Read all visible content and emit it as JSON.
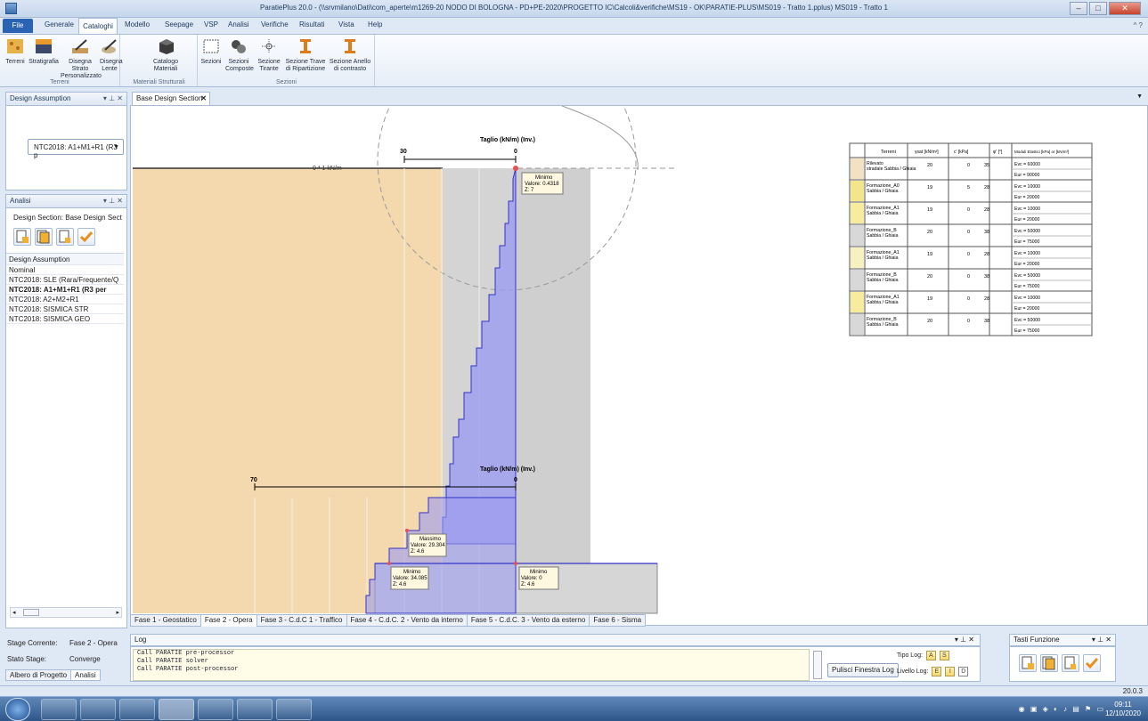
{
  "window": {
    "title": "ParatiePlus 20.0 - (\\\\srvmilano\\Dati\\com_aperte\\m1269-20  NODO DI BOLOGNA - PD+PE-2020\\PROGETTO IC\\Calcoli&verifiche\\MS19 - OK\\PARATIE-PLUS\\MS019 - Tratto 1.pplus) MS019 - Tratto 1"
  },
  "menu": {
    "file": "File",
    "items": [
      "Generale",
      "Cataloghi",
      "Modello",
      "Seepage",
      "VSP",
      "Analisi",
      "Verifiche",
      "Risultati",
      "Vista",
      "Help"
    ],
    "active": "Cataloghi"
  },
  "ribbon": {
    "groups": [
      {
        "label": "Terreni",
        "buttons": [
          "Terreni",
          "Stratigrafia",
          "Disegna Strato Personalizzato",
          "Disegna Lente"
        ]
      },
      {
        "label": "Materiali Strutturali",
        "buttons": [
          "Catalogo Materiali"
        ]
      },
      {
        "label": "Sezioni",
        "buttons": [
          "Sezioni",
          "Sezioni Composte",
          "Sezione Tirante",
          "Sezione Trave di Ripartizione",
          "Sezione Anello di contrasto"
        ]
      }
    ]
  },
  "design_panel": {
    "title": "Design Assumption",
    "selected": "NTC2018: A1+M1+R1 (R3 p"
  },
  "analisi_panel": {
    "title": "Analisi",
    "section_label": "Design Section:  Base Design Sect",
    "list_header": "Design Assumption",
    "items": [
      "Nominal",
      "NTC2018: SLE (Rara/Frequente/Q",
      "NTC2018: A1+M1+R1 (R3 per",
      "NTC2018: A2+M2+R1",
      "NTC2018: SISMICA STR",
      "NTC2018: SISMICA GEO"
    ],
    "bold_item": 2
  },
  "doc_tab": "Base Design Section",
  "canvas": {
    "chart1": {
      "title": "Taglio (kN/m) (Inv.)",
      "left_tick": "30",
      "right_tick": "0"
    },
    "chart2": {
      "title": "Taglio (kN/m) (Inv.)",
      "left_tick": "70",
      "right_tick": "0"
    },
    "load_label": "0 * 1 kN/m",
    "tooltips": [
      {
        "lines": [
          "Minimo",
          "Valore: 0.4318",
          "Z:       7"
        ]
      },
      {
        "lines": [
          "Massimo",
          "Valore: 29.304",
          "Z:       4.6"
        ]
      },
      {
        "lines": [
          "Minimo",
          "Valore: 34.085",
          "Z:       4.6"
        ]
      },
      {
        "lines": [
          "Minimo",
          "Valore:  0",
          "Z:       4.6"
        ]
      }
    ],
    "soil_table": {
      "headers": [
        "Terreni",
        "γsat [kN/m³]",
        "c' [kPa]",
        "φ' [°]",
        "Moduli Elastici [kPa] or [kN/m³]"
      ],
      "rows": [
        {
          "name": "Rilevato stradale Sabbia / Ghiaia",
          "gamma": "20",
          "c": "0",
          "phi": "35",
          "evc": "Evc = 60000",
          "eur": "Eur = 90000"
        },
        {
          "name": "Formazione_A0 Sabbia / Ghiaia",
          "gamma": "19",
          "c": "5",
          "phi": "28",
          "evc": "Evc = 10000",
          "eur": "Eur = 20000"
        },
        {
          "name": "Formazione_A1 Sabbia / Ghiaia",
          "gamma": "19",
          "c": "0",
          "phi": "28",
          "evc": "Evc = 10000",
          "eur": "Eur = 20000"
        },
        {
          "name": "Formazione_B Sabbia / Ghiaia",
          "gamma": "20",
          "c": "0",
          "phi": "38",
          "evc": "Evc = 50000",
          "eur": "Eur = 75000"
        },
        {
          "name": "Formazione_A1 Sabbia / Ghiaia",
          "gamma": "19",
          "c": "0",
          "phi": "28",
          "evc": "Evc = 10000",
          "eur": "Eur = 20000"
        },
        {
          "name": "Formazione_B Sabbia / Ghiaia",
          "gamma": "20",
          "c": "0",
          "phi": "38",
          "evc": "Evc = 50000",
          "eur": "Eur = 75000"
        },
        {
          "name": "Formazione_A1 Sabbia / Ghiaia",
          "gamma": "19",
          "c": "0",
          "phi": "28",
          "evc": "Evc = 10000",
          "eur": "Eur = 20000"
        },
        {
          "name": "Formazione_B Sabbia / Ghiaia",
          "gamma": "20",
          "c": "0",
          "phi": "38",
          "evc": "Evc = 50000",
          "eur": "Eur = 75000"
        }
      ]
    }
  },
  "phase_tabs": [
    "Fase 1 - Geostatico",
    "Fase 2 - Opera",
    "Fase 3 - C.d.C 1 - Traffico",
    "Fase 4 - C.d.C. 2 - Vento da interno",
    "Fase 5 - C.d.C. 3 - Vento da esterno",
    "Fase 6 - Sisma"
  ],
  "active_phase": 1,
  "stage": {
    "current_label": "Stage Corrente:",
    "current_value": "Fase 2 - Opera",
    "state_label": "Stato Stage:",
    "state_value": "Converge"
  },
  "bottom_tabs": [
    "Albero di Progetto",
    "Analisi"
  ],
  "log": {
    "title": "Log",
    "lines": [
      "Call PARATIE pre-processor",
      "Call PARATIE solver",
      "Call PARATIE post-processor"
    ],
    "clear_button": "Pulisci Finestra Log",
    "tipo_label": "Tipo Log:",
    "tipo_values": [
      "A",
      "S"
    ],
    "livello_label": "Livello Log:",
    "livello_values": [
      "E",
      "I",
      "D"
    ]
  },
  "func_panel": {
    "title": "Tasti Funzione"
  },
  "status": {
    "version": "20.0.3"
  },
  "taskbar": {
    "time": "09:11",
    "date": "12/10/2020"
  },
  "colors": {
    "soil_orange": "#f5d9ae",
    "wall_gray": "#d4d4d4",
    "shear_blue": "#9b9bf0",
    "line_blue": "#3434c8"
  }
}
